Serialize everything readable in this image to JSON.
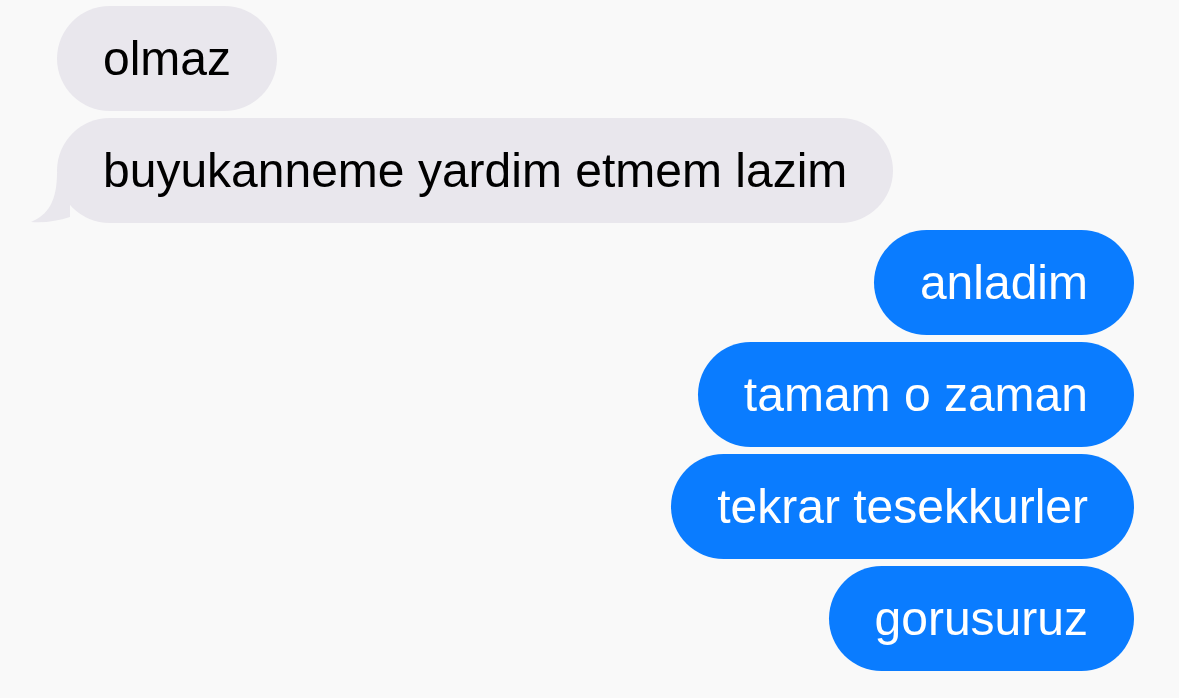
{
  "messages": [
    {
      "kind": "received",
      "text": "olmaz",
      "tail": false
    },
    {
      "kind": "received",
      "text": "buyukanneme yardim etmem lazim",
      "tail": true
    },
    {
      "kind": "sent",
      "text": "anladim",
      "tail": false
    },
    {
      "kind": "sent",
      "text": "tamam o zaman",
      "tail": false
    },
    {
      "kind": "sent",
      "text": "tekrar tesekkurler",
      "tail": false
    },
    {
      "kind": "sent",
      "text": "gorusuruz",
      "tail": false
    }
  ]
}
